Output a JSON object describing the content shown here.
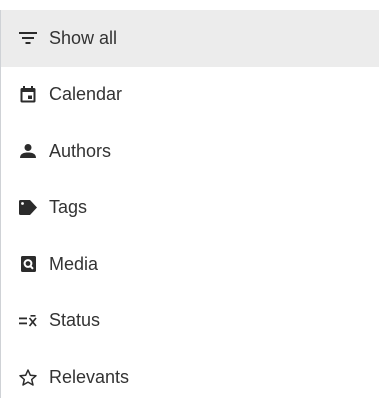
{
  "menu": {
    "items": [
      {
        "label": "Show all",
        "icon": "filter-list-icon",
        "selected": true
      },
      {
        "label": "Calendar",
        "icon": "calendar-icon",
        "selected": false
      },
      {
        "label": "Authors",
        "icon": "person-icon",
        "selected": false
      },
      {
        "label": "Tags",
        "icon": "tag-icon",
        "selected": false
      },
      {
        "label": "Media",
        "icon": "media-search-icon",
        "selected": false
      },
      {
        "label": "Status",
        "icon": "status-filter-icon",
        "selected": false
      },
      {
        "label": "Relevants",
        "icon": "star-outline-icon",
        "selected": false
      }
    ]
  },
  "colors": {
    "selected_background": "#ececec",
    "text": "#333333",
    "icon": "#2b2b2b",
    "border": "#cfd2d6"
  }
}
